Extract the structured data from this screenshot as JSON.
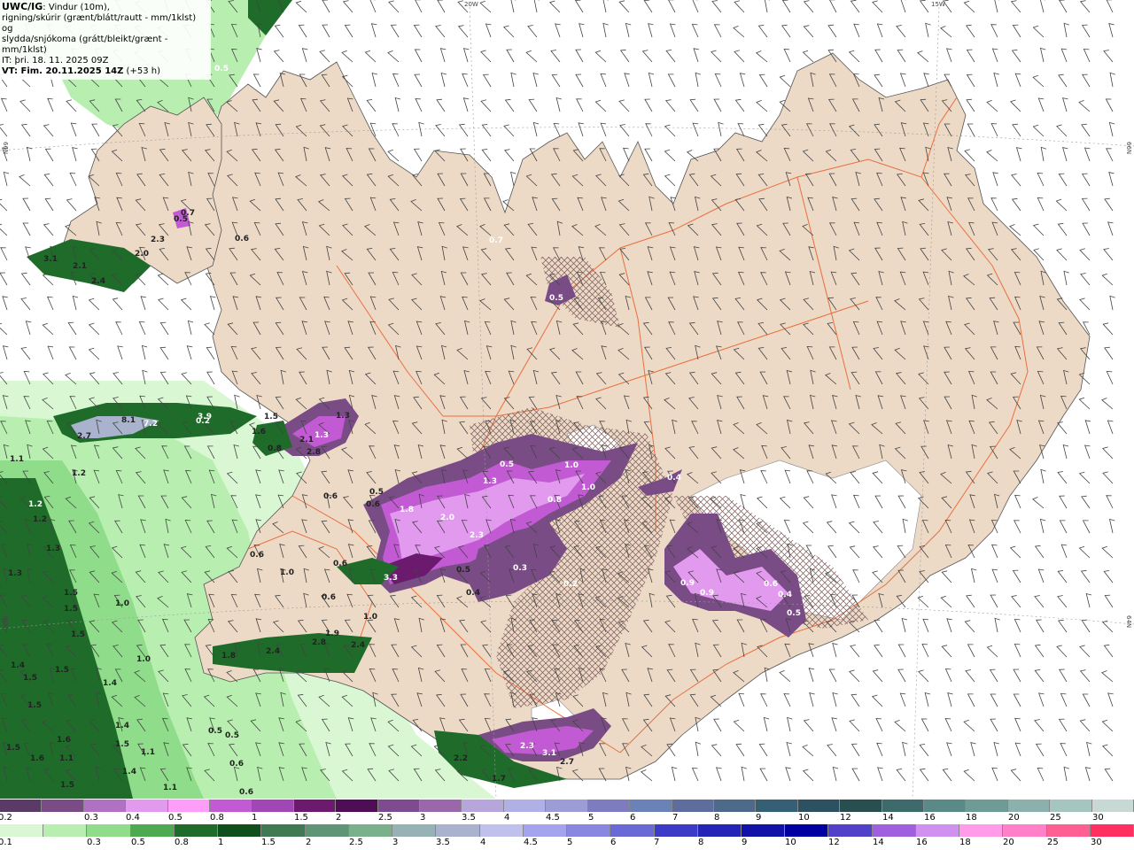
{
  "header": {
    "title": "UWC/IG",
    "title_suffix": ": Vindur (10m),",
    "line2": "rigning/skúrir (grænt/blátt/rautt - mm/1klst) og",
    "line3": "slydda/snjókoma (grátt/bleikt/grænt - mm/1klst)",
    "it": "IT: þri. 18. 11. 2025 09Z",
    "vt": "VT: Fim. 20.11.2025 14Z",
    "vt_suffix": " (+53 h)"
  },
  "coords": {
    "lon_20": "20W",
    "lon_15": "15W",
    "lat_66_left": "66N",
    "lat_66_right": "66N",
    "lat_64_left": "64N",
    "lat_64_right": "64N"
  },
  "colors": {
    "land": "#ecd9c6",
    "road": "#e8703f",
    "snow_top": [
      "#5a3a66",
      "#7a4c86",
      "#b070c4",
      "#e29aee",
      "#ff9df8",
      "#c25bd3",
      "#a047b5",
      "#6b1a6e",
      "#4e0d55",
      "#7e4b91",
      "#9a67aa",
      "#b6a6dc",
      "#b0b0e6",
      "#9c9cd6",
      "#7d7cc0",
      "#6b82b8",
      "#5f6d9e",
      "#4e6a8a",
      "#355f75",
      "#2c5262",
      "#284e50",
      "#3d6a6a",
      "#5a8a88",
      "#6f9b97",
      "#8cb1ad",
      "#a5c5c0",
      "#c8d8d4",
      "#ffffff"
    ],
    "rain_bottom": [
      "#d8f7d2",
      "#b8efb0",
      "#8fdd8a",
      "#4daa50",
      "#1f6b2a",
      "#0f4f1c",
      "#3f7a52",
      "#5f9575",
      "#7ab08c",
      "#97b2b4",
      "#a9b3ce",
      "#c0c0ec",
      "#a4a4ee",
      "#8888e0",
      "#6a6ad6",
      "#3b3bc8",
      "#2424b6",
      "#1212a8",
      "#0000a0",
      "#5240c8",
      "#a060de",
      "#d090f0",
      "#ff9be8",
      "#ff7fc8",
      "#ff5f92",
      "#ff3060",
      "#ff1a1a"
    ]
  },
  "colorbar_top": {
    "labels": [
      "0.2",
      "0.3",
      "0.4",
      "0.5",
      "0.8",
      "1",
      "1.5",
      "2",
      "2.5",
      "3",
      "3.5",
      "4",
      "4.5",
      "5",
      "6",
      "7",
      "8",
      "9",
      "10",
      "12",
      "14",
      "16",
      "18",
      "20",
      "25",
      "30"
    ]
  },
  "colorbar_bottom": {
    "labels": [
      "0.1",
      "0.3",
      "0.5",
      "0.8",
      "1",
      "1.5",
      "2",
      "2.5",
      "3",
      "3.5",
      "4",
      "4.5",
      "5",
      "6",
      "7",
      "8",
      "9",
      "10",
      "12",
      "14",
      "16",
      "18",
      "20",
      "25",
      "30"
    ]
  },
  "labels": [
    {
      "t": "0.5"
    },
    {
      "t": "3.1"
    },
    {
      "t": "2.1"
    },
    {
      "t": "2.4"
    },
    {
      "t": "2.0"
    },
    {
      "t": "2.3"
    },
    {
      "t": "0.7"
    },
    {
      "t": "0.5"
    },
    {
      "t": "0.6"
    },
    {
      "t": "0.7"
    },
    {
      "t": "0.5"
    },
    {
      "t": "2.7"
    },
    {
      "t": "8.1"
    },
    {
      "t": "7.2"
    },
    {
      "t": "0.2"
    },
    {
      "t": "3.9"
    },
    {
      "t": "1.5"
    },
    {
      "t": "1.3"
    },
    {
      "t": "2.1"
    },
    {
      "t": "1.3"
    },
    {
      "t": "0.8"
    },
    {
      "t": "2.8"
    },
    {
      "t": "1.6"
    },
    {
      "t": "1.1"
    },
    {
      "t": "1.2"
    },
    {
      "t": "1.2"
    },
    {
      "t": "1.2"
    },
    {
      "t": "1.3"
    },
    {
      "t": "1.3"
    },
    {
      "t": "1.5"
    },
    {
      "t": "1.5"
    },
    {
      "t": "1.5"
    },
    {
      "t": "1.0"
    },
    {
      "t": "1.0"
    },
    {
      "t": "1.4"
    },
    {
      "t": "1.5"
    },
    {
      "t": "1.5"
    },
    {
      "t": "1.4"
    },
    {
      "t": "1.5"
    },
    {
      "t": "1.6"
    },
    {
      "t": "1.4"
    },
    {
      "t": "1.5"
    },
    {
      "t": "1.5"
    },
    {
      "t": "1.6"
    },
    {
      "t": "1.1"
    },
    {
      "t": "1.1"
    },
    {
      "t": "1.5"
    },
    {
      "t": "1.4"
    },
    {
      "t": "1.1"
    },
    {
      "t": "0.5"
    },
    {
      "t": "0.5"
    },
    {
      "t": "0.6"
    },
    {
      "t": "0.6"
    },
    {
      "t": "0.6"
    },
    {
      "t": "0.6"
    },
    {
      "t": "1.0"
    },
    {
      "t": "0.6"
    },
    {
      "t": "0.6"
    },
    {
      "t": "1.0"
    },
    {
      "t": "1.8"
    },
    {
      "t": "2.4"
    },
    {
      "t": "2.8"
    },
    {
      "t": "1.9"
    },
    {
      "t": "2.4"
    },
    {
      "t": "0.5"
    },
    {
      "t": "0.6"
    },
    {
      "t": "1.8"
    },
    {
      "t": "2.0"
    },
    {
      "t": "2.3"
    },
    {
      "t": "3.3"
    },
    {
      "t": "0.5"
    },
    {
      "t": "1.3"
    },
    {
      "t": "0.5"
    },
    {
      "t": "1.0"
    },
    {
      "t": "1.0"
    },
    {
      "t": "0.8"
    },
    {
      "t": "0.4"
    },
    {
      "t": "0.3"
    },
    {
      "t": "0.2"
    },
    {
      "t": "0.4"
    },
    {
      "t": "0.9"
    },
    {
      "t": "0.9"
    },
    {
      "t": "0.6"
    },
    {
      "t": "0.4"
    },
    {
      "t": "0.5"
    },
    {
      "t": "2.3"
    },
    {
      "t": "3.1"
    },
    {
      "t": "2.7"
    },
    {
      "t": "2.2"
    },
    {
      "t": "1.7"
    }
  ]
}
